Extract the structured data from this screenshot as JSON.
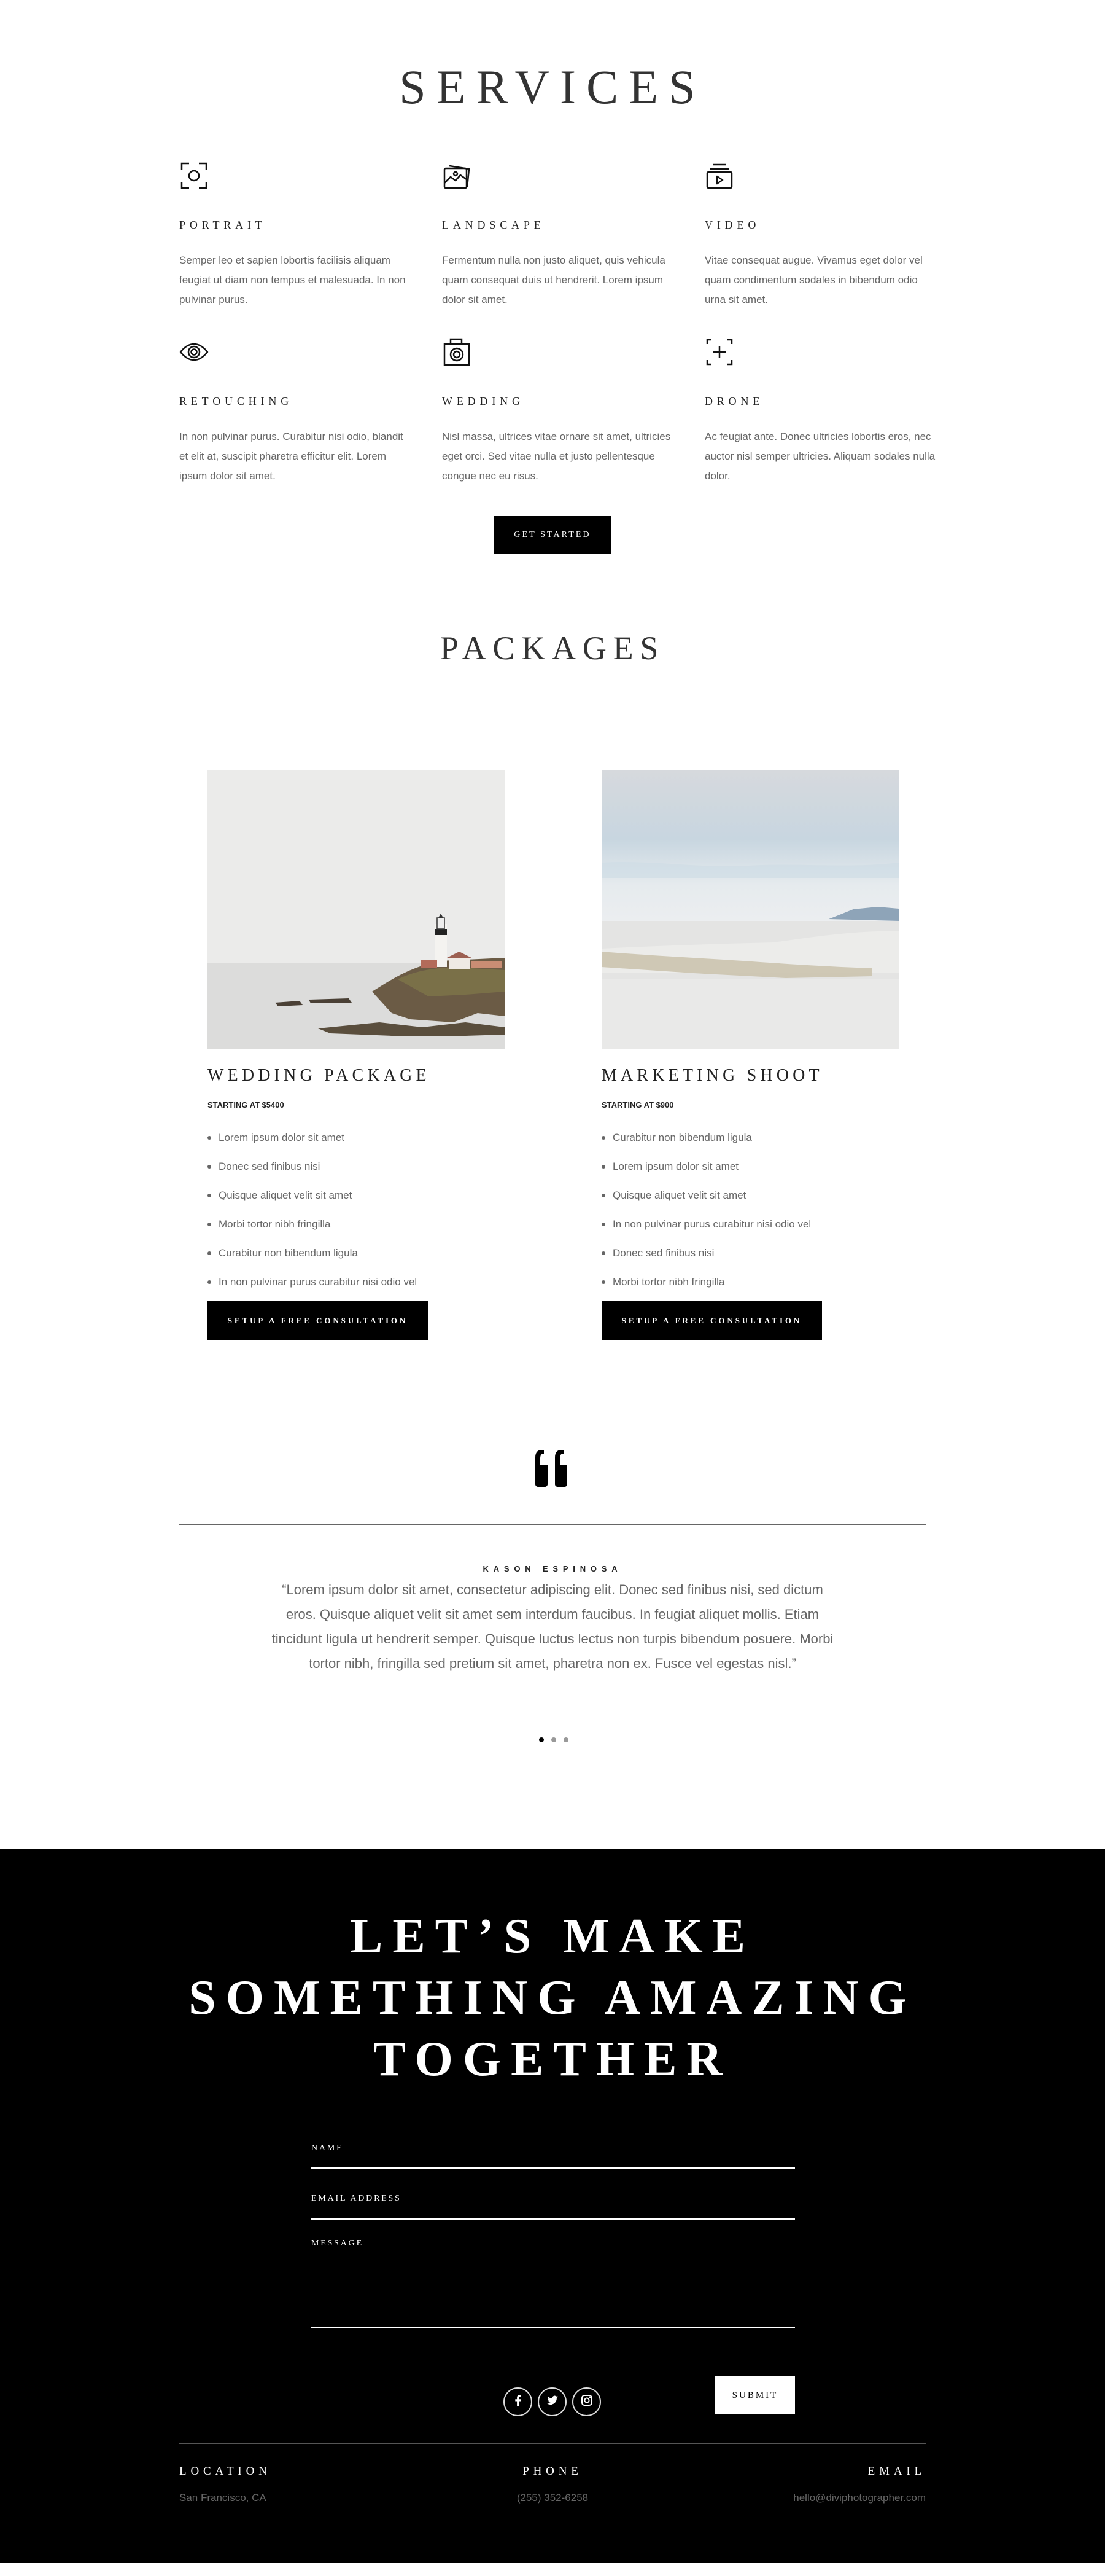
{
  "services": {
    "title": "SERVICES",
    "items": [
      {
        "icon": "portrait-focus-icon",
        "title": "PORTRAIT",
        "desc": "Semper leo et sapien lobortis facilisis aliquam feugiat ut diam non tempus et malesuada. In non pulvinar purus."
      },
      {
        "icon": "landscape-photos-icon",
        "title": "LANDSCAPE",
        "desc": "Fermentum nulla non justo aliquet, quis vehicula quam consequat duis ut hendrerit. Lorem ipsum dolor sit amet."
      },
      {
        "icon": "video-play-icon",
        "title": "VIDEO",
        "desc": "Vitae consequat augue. Vivamus eget dolor vel quam condimentum sodales in bibendum odio urna sit amet."
      },
      {
        "icon": "eye-icon",
        "title": "RETOUCHING",
        "desc": "In non pulvinar purus. Curabitur nisi odio, blandit et elit at, suscipit pharetra efficitur elit. Lorem ipsum dolor sit amet."
      },
      {
        "icon": "camera-icon",
        "title": "WEDDING",
        "desc": "Nisl massa, ultrices vitae ornare sit amet, ultricies eget orci. Sed vitae nulla et justo pellentesque congue nec eu risus."
      },
      {
        "icon": "drone-crosshair-icon",
        "title": "DRONE",
        "desc": "Ac feugiat ante. Donec ultricies lobortis eros, nec auctor nisl semper ultricies. Aliquam sodales nulla dolor."
      }
    ],
    "cta_label": "GET STARTED"
  },
  "packages": {
    "title": "PACKAGES",
    "items": [
      {
        "image": "lighthouse-on-rocky-coast",
        "title": "WEDDING PACKAGE",
        "price": "STARTING AT $5400",
        "features": [
          "Lorem ipsum dolor sit amet",
          "Donec sed finibus nisi",
          "Quisque aliquet velit sit amet",
          "Morbi tortor nibh fringilla",
          "Curabitur non bibendum ligula",
          "In non pulvinar purus curabitur nisi odio vel"
        ],
        "button": "SETUP A FREE CONSULTATION"
      },
      {
        "image": "white-sand-dunes-landscape",
        "title": "MARKETING SHOOT",
        "price": "STARTING AT $900",
        "features": [
          "Curabitur non bibendum ligula",
          "Lorem ipsum dolor sit amet",
          "Quisque aliquet velit sit amet",
          "In non pulvinar purus curabitur nisi odio vel",
          "Donec sed finibus nisi",
          "Morbi tortor nibh fringilla"
        ],
        "button": "SETUP A FREE CONSULTATION"
      }
    ]
  },
  "testimonial": {
    "icon": "quote-icon",
    "name": "KASON ESPINOSA",
    "text": "“Lorem ipsum dolor sit amet, consectetur adipiscing elit. Donec sed finibus nisi, sed dictum eros. Quisque aliquet velit sit amet sem interdum faucibus. In feugiat aliquet mollis. Etiam tincidunt ligula ut hendrerit semper. Quisque luctus lectus non turpis bibendum posuere. Morbi tortor nibh, fringilla sed pretium sit amet, pharetra non ex. Fusce vel egestas nisl.”",
    "slides": 3,
    "active_slide": 1
  },
  "contact": {
    "headline_lines": [
      "LET’S MAKE",
      "SOMETHING AMAZING",
      "TOGETHER"
    ],
    "fields": {
      "name_label": "NAME",
      "name_value": "",
      "email_label": "EMAIL ADDRESS",
      "email_value": "",
      "message_label": "MESSAGE",
      "message_value": ""
    },
    "submit_label": "SUBMIT",
    "socials": [
      "facebook",
      "twitter",
      "instagram"
    ],
    "info": {
      "location_label": "LOCATION",
      "location_value": "San Francisco, CA",
      "phone_label": "PHONE",
      "phone_value": "(255) 352-6258",
      "email_label": "EMAIL",
      "email_value": "hello@diviphotographer.com"
    }
  },
  "colors": {
    "text_dark": "#222222",
    "text_body": "#666666",
    "black": "#000000",
    "white": "#ffffff",
    "dot_inactive": "#999999"
  }
}
